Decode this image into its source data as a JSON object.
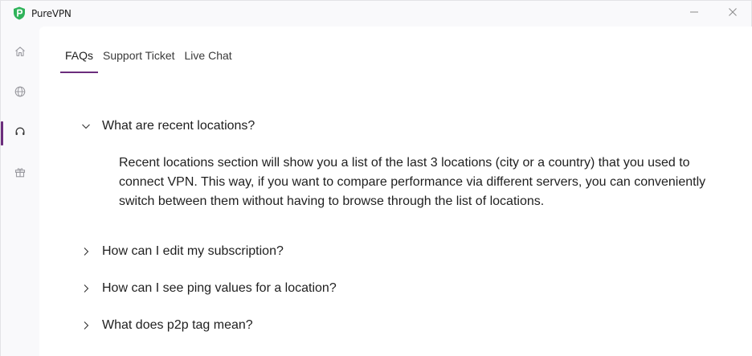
{
  "window": {
    "title": "PureVPN",
    "minimize_glyph": "—",
    "close_glyph": "✕",
    "accent_color": "#6b2d7c",
    "logo_color": "#2fb35a"
  },
  "sidebar": {
    "items": [
      {
        "name": "home",
        "icon": "home-icon",
        "active": false
      },
      {
        "name": "locations",
        "icon": "globe-icon",
        "active": false
      },
      {
        "name": "support",
        "icon": "headset-icon",
        "active": true
      },
      {
        "name": "gifts",
        "icon": "gift-icon",
        "active": false
      }
    ]
  },
  "tabs": [
    {
      "label": "FAQs",
      "active": true
    },
    {
      "label": "Support Ticket",
      "active": false
    },
    {
      "label": "Live Chat",
      "active": false
    }
  ],
  "faqs": [
    {
      "question": "What are recent locations?",
      "expanded": true,
      "answer": "Recent locations section will show you a list of the last 3 locations (city or a country) that you used to connect VPN. This way, if you want to compare performance via different servers, you can conveniently switch between them without having to browse through the list of locations."
    },
    {
      "question": "How can I edit my subscription?",
      "expanded": false
    },
    {
      "question": "How can I see ping values for a location?",
      "expanded": false
    },
    {
      "question": "What does p2p tag mean?",
      "expanded": false
    }
  ]
}
